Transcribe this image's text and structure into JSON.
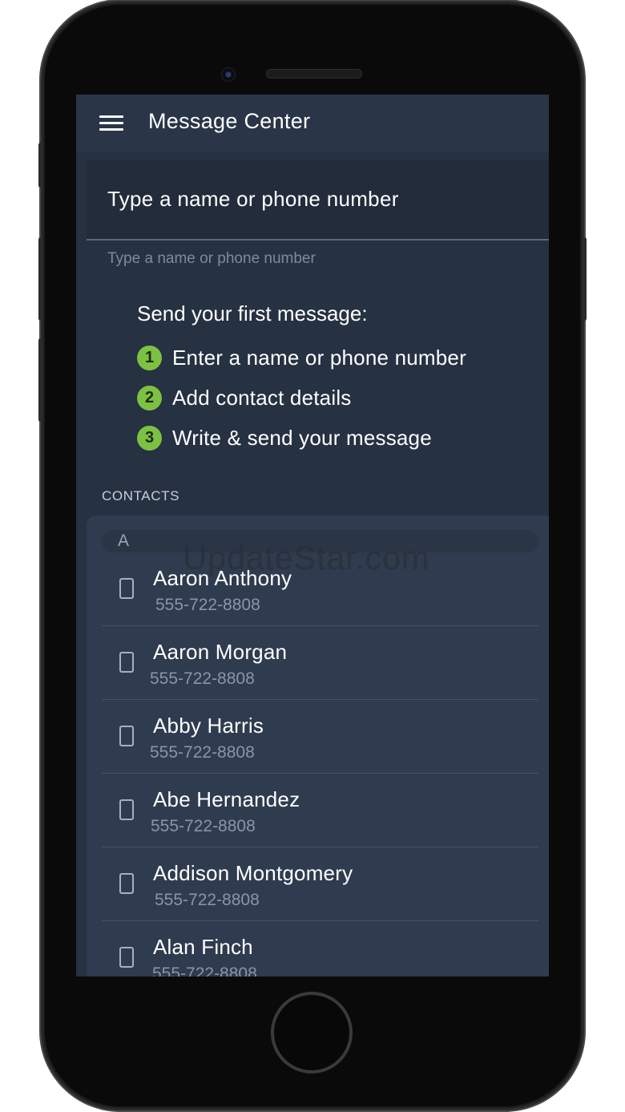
{
  "app": {
    "title": "Message Center"
  },
  "search": {
    "placeholder": "Type a name or phone number",
    "helper": "Type a name or phone number"
  },
  "instructions": {
    "title": "Send your first message:",
    "steps": [
      {
        "number": "1",
        "text": "Enter a name or phone number"
      },
      {
        "number": "2",
        "text": "Add contact details"
      },
      {
        "number": "3",
        "text": "Write & send your message"
      }
    ]
  },
  "contacts": {
    "section_label": "CONTACTS",
    "group_letter": "A",
    "items": [
      {
        "name": "Aaron Anthony",
        "number": "555-722-8808"
      },
      {
        "name": "Aaron Morgan",
        "number": "555-722-8808"
      },
      {
        "name": "Abby Harris",
        "number": "555-722-8808"
      },
      {
        "name": "Abe Hernandez",
        "number": "555-722-8808"
      },
      {
        "name": "Addison Montgomery",
        "number": "555-722-8808"
      },
      {
        "name": "Alan Finch",
        "number": "555-722-8808"
      }
    ]
  },
  "watermark": "UpdateStar.com",
  "icons": {
    "menu": "hamburger-menu-icon",
    "contact": "mobile-phone-icon"
  },
  "colors": {
    "background": "#263142",
    "app_bar": "#2a3547",
    "accent_green": "#7cc142",
    "contact_panel": "#2f3b4e"
  }
}
